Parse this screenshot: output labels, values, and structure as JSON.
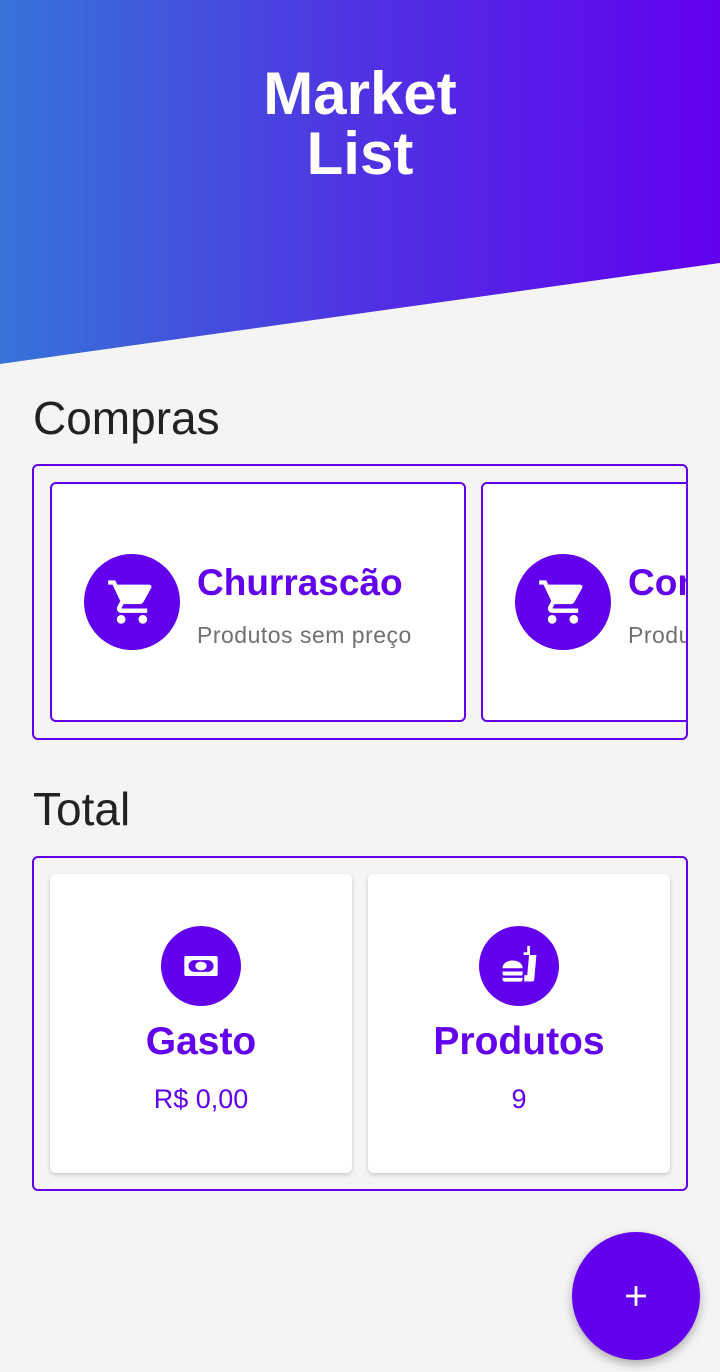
{
  "header": {
    "title_line1": "Market",
    "title_line2": "List"
  },
  "compras": {
    "title": "Compras",
    "lists": [
      {
        "name": "Churrascão",
        "subtitle": "Produtos sem preço",
        "icon": "shopping-cart-icon"
      },
      {
        "name": "Com",
        "subtitle": "Produ",
        "icon": "shopping-cart-icon"
      }
    ]
  },
  "total": {
    "title": "Total",
    "gasto": {
      "label": "Gasto",
      "value": "R$ 0,00",
      "icon": "money-icon"
    },
    "produtos": {
      "label": "Produtos",
      "value": "9",
      "icon": "fastfood-icon"
    }
  },
  "fab": {
    "icon": "plus-icon"
  },
  "colors": {
    "primary": "#6200ee",
    "gradient_start": "#3674d8",
    "background": "#f5f4f5"
  }
}
